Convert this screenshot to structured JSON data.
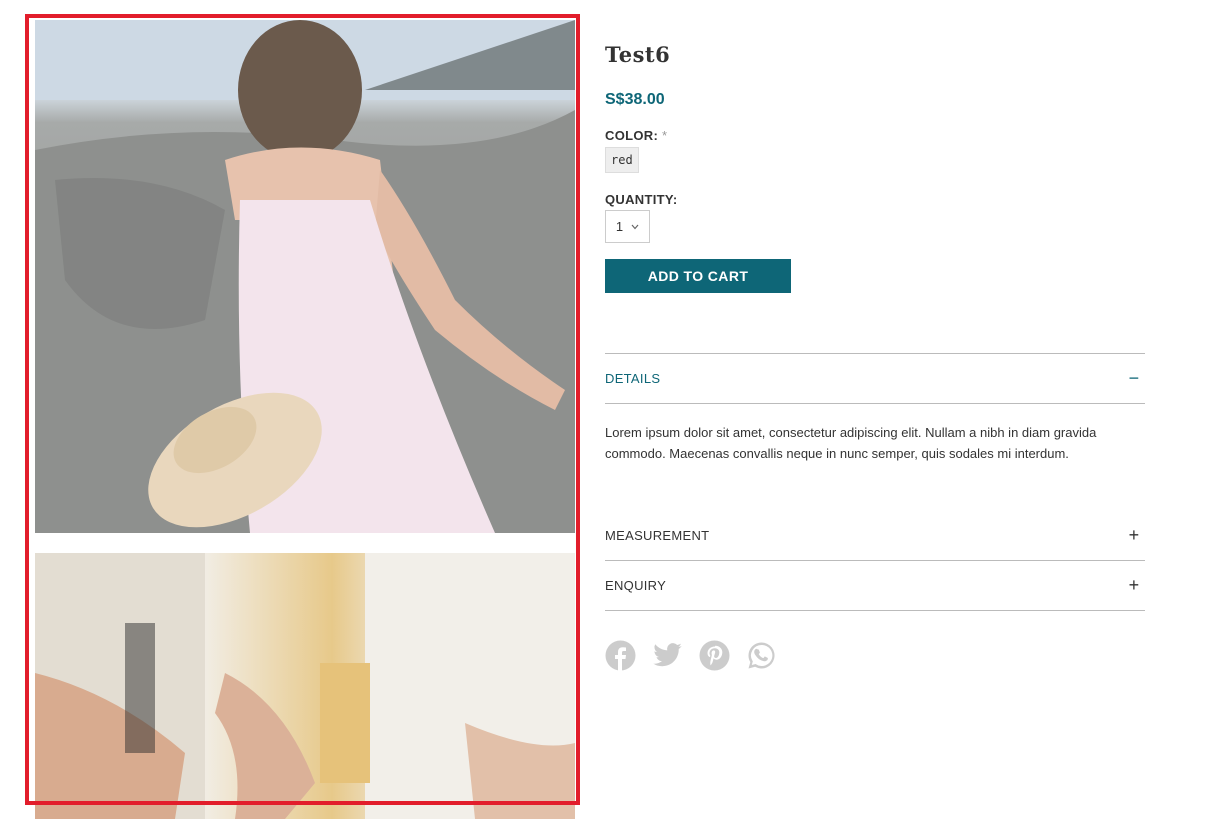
{
  "product": {
    "title": "Test6",
    "price": "S$38.00",
    "color_label": "COLOR:",
    "required_mark": "*",
    "color_value": "red",
    "quantity_label": "QUANTITY:",
    "quantity_value": "1",
    "add_to_cart": "ADD TO CART"
  },
  "accordion": {
    "details_label": "DETAILS",
    "details_text": "Lorem ipsum dolor sit amet, consectetur adipiscing elit. Nullam a nibh in diam gravida commodo. Maecenas convallis neque in nunc semper, quis sodales mi interdum.",
    "measurement_label": "MEASUREMENT",
    "enquiry_label": "ENQUIRY",
    "expanded_sign": "−",
    "collapsed_sign": "+"
  },
  "social": {
    "icons": [
      "facebook-icon",
      "twitter-icon",
      "pinterest-icon",
      "whatsapp-icon"
    ],
    "icon_color": "#cccccc"
  },
  "colors": {
    "accent": "#0e6677",
    "highlight_border": "#e21d2b"
  }
}
